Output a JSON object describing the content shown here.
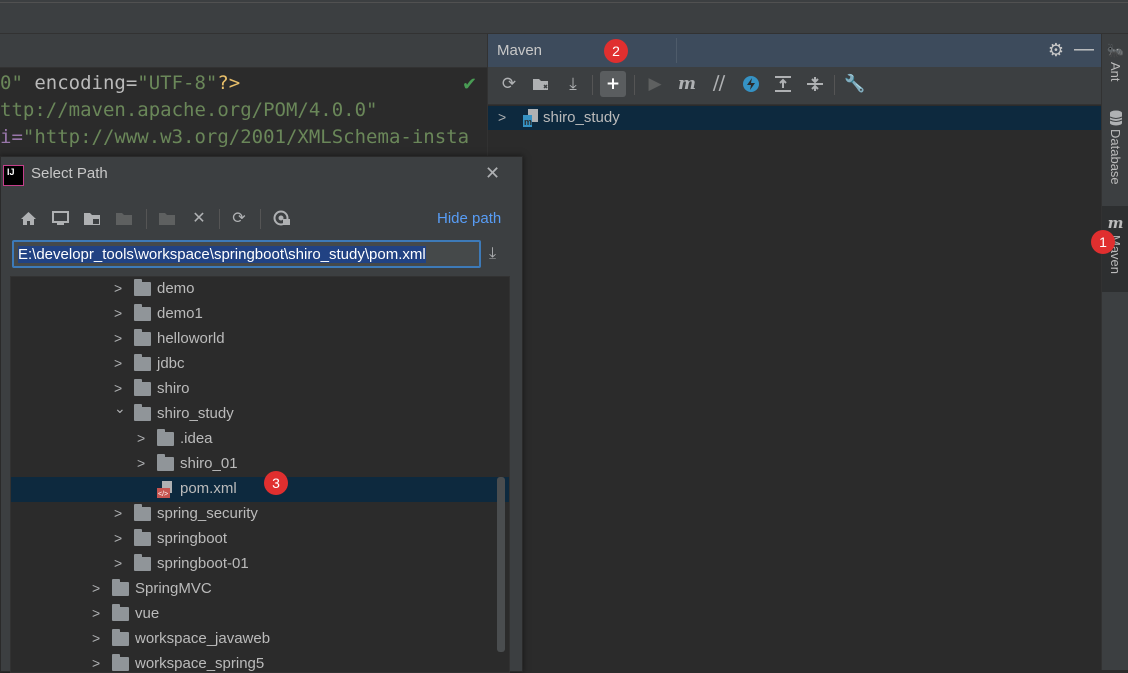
{
  "editor": {
    "lines": [
      {
        "parts": [
          "0\"",
          " encoding=",
          "\"UTF-8\"",
          "?>"
        ]
      },
      {
        "parts": [
          "ttp://maven.apache.org/POM/4.0.0\""
        ]
      },
      {
        "parts": [
          "i=",
          "\"http://www.w3.org/2001/XMLSchema-insta"
        ]
      }
    ]
  },
  "maven": {
    "title": "Maven",
    "toolbar": [
      "reload-icon",
      "add-folder-icon",
      "download-icon",
      "plus-icon",
      "run-icon",
      "maven-m-icon",
      "toggle-offline-icon",
      "lightning-icon",
      "collapse-icon",
      "expand-icon",
      "wrench-icon"
    ],
    "tree": [
      {
        "label": "shiro_study",
        "expanded": false,
        "selected": true
      }
    ],
    "badge": "2"
  },
  "right_strip": {
    "tabs": [
      {
        "label": "Ant",
        "icon": "ant-icon"
      },
      {
        "label": "Database",
        "icon": "database-icon"
      },
      {
        "label": "Maven",
        "icon": "maven-m-icon",
        "active": true
      }
    ],
    "badge": "1"
  },
  "dialog": {
    "title": "Select Path",
    "hide_path": "Hide path",
    "path_value": "E:\\developr_tools\\workspace\\springboot\\shiro_study\\pom.xml",
    "badge": "3",
    "tree": [
      {
        "label": "demo",
        "depth": 1,
        "chevron": ">"
      },
      {
        "label": "demo1",
        "depth": 1,
        "chevron": ">"
      },
      {
        "label": "helloworld",
        "depth": 1,
        "chevron": ">"
      },
      {
        "label": "jdbc",
        "depth": 1,
        "chevron": ">"
      },
      {
        "label": "shiro",
        "depth": 1,
        "chevron": ">"
      },
      {
        "label": "shiro_study",
        "depth": 1,
        "chevron": "v"
      },
      {
        "label": ".idea",
        "depth": 2,
        "chevron": ">"
      },
      {
        "label": "shiro_01",
        "depth": 2,
        "chevron": ">"
      },
      {
        "label": "pom.xml",
        "depth": 2,
        "chevron": "",
        "file": true,
        "selected": true
      },
      {
        "label": "spring_security",
        "depth": 1,
        "chevron": ">"
      },
      {
        "label": "springboot",
        "depth": 1,
        "chevron": ">"
      },
      {
        "label": "springboot-01",
        "depth": 1,
        "chevron": ">"
      },
      {
        "label": "SpringMVC",
        "depth": 0,
        "chevron": ">"
      },
      {
        "label": "vue",
        "depth": 0,
        "chevron": ">"
      },
      {
        "label": "workspace_javaweb",
        "depth": 0,
        "chevron": ">"
      },
      {
        "label": "workspace_spring5",
        "depth": 0,
        "chevron": ">"
      }
    ]
  },
  "colors": {
    "selection": "#0d293e",
    "accent_link": "#589df6",
    "badge": "#e02f2f"
  }
}
